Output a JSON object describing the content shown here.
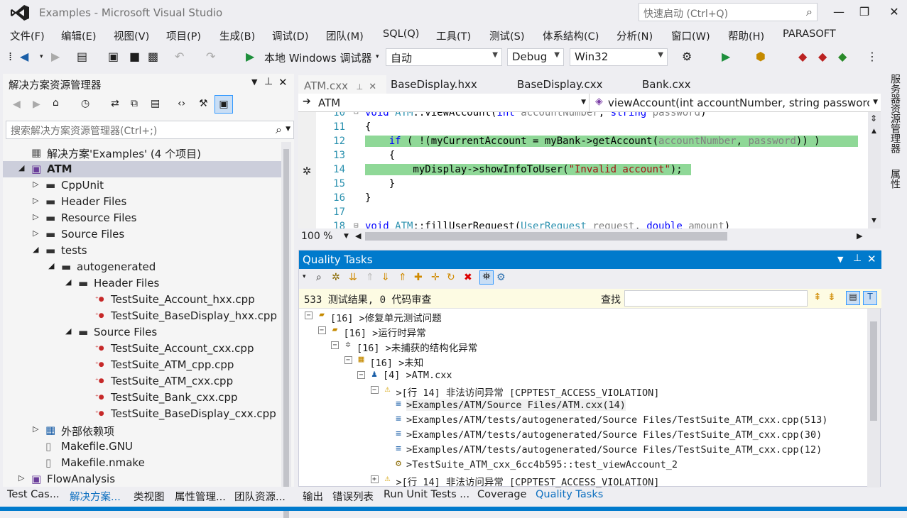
{
  "title": "Examples - Microsoft Visual Studio",
  "quick_launch_placeholder": "快速启动 (Ctrl+Q)",
  "menu": [
    "文件(F)",
    "编辑(E)",
    "视图(V)",
    "项目(P)",
    "生成(B)",
    "调试(D)",
    "团队(M)",
    "SQL(Q)",
    "工具(T)",
    "测试(S)",
    "体系结构(C)",
    "分析(N)",
    "窗口(W)",
    "帮助(H)",
    "PARASOFT"
  ],
  "toolbar": {
    "debugger_label": "本地 Windows 调试器",
    "config_auto": "自动",
    "config": "Debug",
    "platform": "Win32"
  },
  "solution_explorer": {
    "title": "解决方案资源管理器",
    "search_placeholder": "搜索解决方案资源管理器(Ctrl+;)",
    "items": [
      {
        "label": "解决方案'Examples' (4 个项目)",
        "level": 0,
        "exp": "",
        "icon": "solution-icon"
      },
      {
        "label": "ATM",
        "level": 0,
        "exp": "◢",
        "icon": "project-icon",
        "selected": true
      },
      {
        "label": "CppUnit",
        "level": 1,
        "exp": "▷",
        "icon": "filter-icon"
      },
      {
        "label": "Header Files",
        "level": 1,
        "exp": "▷",
        "icon": "filter-icon"
      },
      {
        "label": "Resource Files",
        "level": 1,
        "exp": "▷",
        "icon": "filter-icon"
      },
      {
        "label": "Source Files",
        "level": 1,
        "exp": "▷",
        "icon": "filter-icon"
      },
      {
        "label": "tests",
        "level": 1,
        "exp": "◢",
        "icon": "filter-icon"
      },
      {
        "label": "autogenerated",
        "level": 2,
        "exp": "◢",
        "icon": "filter-icon"
      },
      {
        "label": "Header Files",
        "level": 3,
        "exp": "◢",
        "icon": "filter-icon"
      },
      {
        "label": "TestSuite_Account_hxx.cpp",
        "level": 4,
        "exp": "",
        "icon": "cpp-file-icon"
      },
      {
        "label": "TestSuite_BaseDisplay_hxx.cpp",
        "level": 4,
        "exp": "",
        "icon": "cpp-file-icon"
      },
      {
        "label": "Source Files",
        "level": 3,
        "exp": "◢",
        "icon": "filter-icon"
      },
      {
        "label": "TestSuite_Account_cxx.cpp",
        "level": 4,
        "exp": "",
        "icon": "cpp-file-icon"
      },
      {
        "label": "TestSuite_ATM_cpp.cpp",
        "level": 4,
        "exp": "",
        "icon": "cpp-file-icon"
      },
      {
        "label": "TestSuite_ATM_cxx.cpp",
        "level": 4,
        "exp": "",
        "icon": "cpp-file-icon"
      },
      {
        "label": "TestSuite_Bank_cxx.cpp",
        "level": 4,
        "exp": "",
        "icon": "cpp-file-icon"
      },
      {
        "label": "TestSuite_BaseDisplay_cxx.cpp",
        "level": 4,
        "exp": "",
        "icon": "cpp-file-icon"
      },
      {
        "label": "外部依赖项",
        "level": 1,
        "exp": "▷",
        "icon": "external-deps-icon"
      },
      {
        "label": "Makefile.GNU",
        "level": 1,
        "exp": "",
        "icon": "file-icon"
      },
      {
        "label": "Makefile.nmake",
        "level": 1,
        "exp": "",
        "icon": "file-icon"
      },
      {
        "label": "FlowAnalysis",
        "level": 0,
        "exp": "▷",
        "icon": "project-icon"
      }
    ]
  },
  "left_tabs": [
    "Test Cas...",
    "解决方案...",
    "类视图",
    "属性管理...",
    "团队资源..."
  ],
  "editor": {
    "tabs": [
      "ATM.cxx",
      "BaseDisplay.hxx",
      "BaseDisplay.cxx",
      "Bank.cxx"
    ],
    "nav_left": "ATM",
    "nav_right": "viewAccount(int accountNumber, string password)",
    "zoom": "100 %",
    "lines": [
      {
        "n": "10",
        "text": "void ATM::viewAccount(int accountNumber, string password)"
      },
      {
        "n": "11",
        "text": "{"
      },
      {
        "n": "12",
        "text": "    if ( !(myCurrentAccount = myBank->getAccount(accountNumber, password)) )"
      },
      {
        "n": "13",
        "text": "    {"
      },
      {
        "n": "14",
        "text": "        myDisplay->showInfoToUser(\"Invalid account\");"
      },
      {
        "n": "15",
        "text": "    }"
      },
      {
        "n": "16",
        "text": "}"
      },
      {
        "n": "17",
        "text": ""
      },
      {
        "n": "18",
        "text": "void ATM::fillUserRequest(UserRequest request, double amount)"
      }
    ]
  },
  "right_strip": [
    "服务器资源管理器",
    "属性"
  ],
  "quality_tasks": {
    "title": "Quality Tasks",
    "status": "533 测试结果, 0 代码审查",
    "find_label": "查找",
    "rows": [
      {
        "level": 0,
        "box": "⊟",
        "icon": "folder-open-icon",
        "text": "[16] >修复单元测试问题"
      },
      {
        "level": 1,
        "box": "⊟",
        "icon": "folder-open-icon",
        "text": "[16] >运行时异常"
      },
      {
        "level": 2,
        "box": "⊟",
        "icon": "bug-icon",
        "text": "[16] >未捕获的结构化异常"
      },
      {
        "level": 3,
        "box": "⊟",
        "icon": "grid-icon",
        "text": "[16] >未知"
      },
      {
        "level": 4,
        "box": "⊟",
        "icon": "person-icon",
        "text": "[4] >ATM.cxx"
      },
      {
        "level": 5,
        "box": "⊟",
        "icon": "warning-icon",
        "text": ">[行 14] 非法访问异常 [CPPTEST_ACCESS_VIOLATION]"
      },
      {
        "level": 6,
        "box": "",
        "icon": "stack-icon",
        "text": ">Examples/ATM/Source Files/ATM.cxx(14)",
        "hl": true
      },
      {
        "level": 6,
        "box": "",
        "icon": "stack-icon",
        "text": ">Examples/ATM/tests/autogenerated/Source Files/TestSuite_ATM_cxx.cpp(513)"
      },
      {
        "level": 6,
        "box": "",
        "icon": "stack-icon",
        "text": ">Examples/ATM/tests/autogenerated/Source Files/TestSuite_ATM_cxx.cpp(30)"
      },
      {
        "level": 6,
        "box": "",
        "icon": "stack-icon",
        "text": ">Examples/ATM/tests/autogenerated/Source Files/TestSuite_ATM_cxx.cpp(12)"
      },
      {
        "level": 6,
        "box": "",
        "icon": "gear-icon",
        "text": ">TestSuite_ATM_cxx_6cc4b595::test_viewAccount_2"
      },
      {
        "level": 5,
        "box": "⊞",
        "icon": "warning-icon",
        "text": ">[行 14] 非法访问异常 [CPPTEST_ACCESS_VIOLATION]"
      }
    ]
  },
  "bottom_tabs": [
    "输出",
    "错误列表",
    "Run Unit Tests ...",
    "Coverage",
    "Quality Tasks"
  ]
}
